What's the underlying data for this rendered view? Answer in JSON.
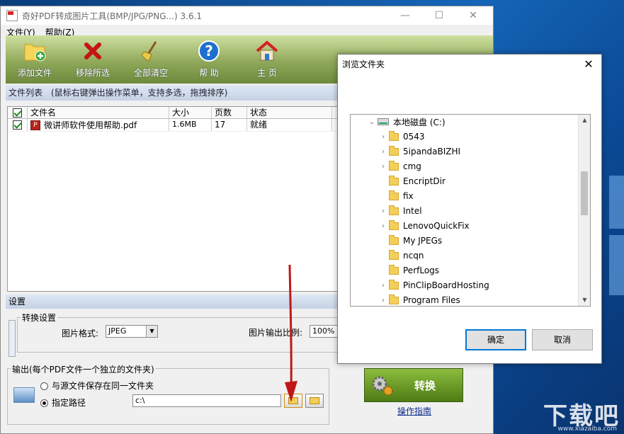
{
  "desktop": {
    "watermark": "下载吧",
    "watermark_sub": "www.xiazaiba.com"
  },
  "app": {
    "title": "奇好PDF转成图片工具(BMP/JPG/PNG...) 3.6.1",
    "menu": [
      "文件(Y)",
      "帮助(Z)"
    ],
    "toolbar": [
      {
        "label": "添加文件",
        "icon": "add-file-icon"
      },
      {
        "label": "移除所选",
        "icon": "remove-icon"
      },
      {
        "label": "全部清空",
        "icon": "broom-icon"
      },
      {
        "label": "帮 助",
        "icon": "help-icon"
      },
      {
        "label": "主 页",
        "icon": "home-icon"
      }
    ],
    "filelist_header": "文件列表　(鼠标右键弹出操作菜单，支持多选，拖拽排序)",
    "table": {
      "columns": [
        "文件名",
        "大小",
        "页数",
        "状态"
      ],
      "rows": [
        {
          "name": "微讲师软件使用帮助.pdf",
          "size": "1.6MB",
          "pages": "17",
          "status": "就绪",
          "checked": true
        }
      ]
    },
    "settings_header": "设置",
    "conversion": {
      "legend": "转换设置",
      "format_label": "图片格式:",
      "format_value": "JPEG",
      "scale_label": "图片输出比例:",
      "scale_value": "100%"
    },
    "output": {
      "legend": "输出(每个PDF文件一个独立的文件夹)",
      "option_same": "与源文件保存在同一文件夹",
      "option_custom": "指定路径",
      "path_value": "c:\\"
    },
    "convert_label": "转换",
    "guide_label": "操作指南"
  },
  "dialog": {
    "title": "浏览文件夹",
    "root": "本地磁盘 (C:)",
    "folders": [
      {
        "name": "0543",
        "expandable": true
      },
      {
        "name": "5ipandaBIZHI",
        "expandable": true
      },
      {
        "name": "cmg",
        "expandable": true
      },
      {
        "name": "EncriptDir",
        "expandable": false
      },
      {
        "name": "fix",
        "expandable": false
      },
      {
        "name": "Intel",
        "expandable": true
      },
      {
        "name": "LenovoQuickFix",
        "expandable": true
      },
      {
        "name": "My JPEGs",
        "expandable": false
      },
      {
        "name": "ncqn",
        "expandable": false
      },
      {
        "name": "PerfLogs",
        "expandable": false
      },
      {
        "name": "PinClipBoardHosting",
        "expandable": true
      },
      {
        "name": "Program Files",
        "expandable": true
      }
    ],
    "ok_label": "确定",
    "cancel_label": "取消"
  }
}
